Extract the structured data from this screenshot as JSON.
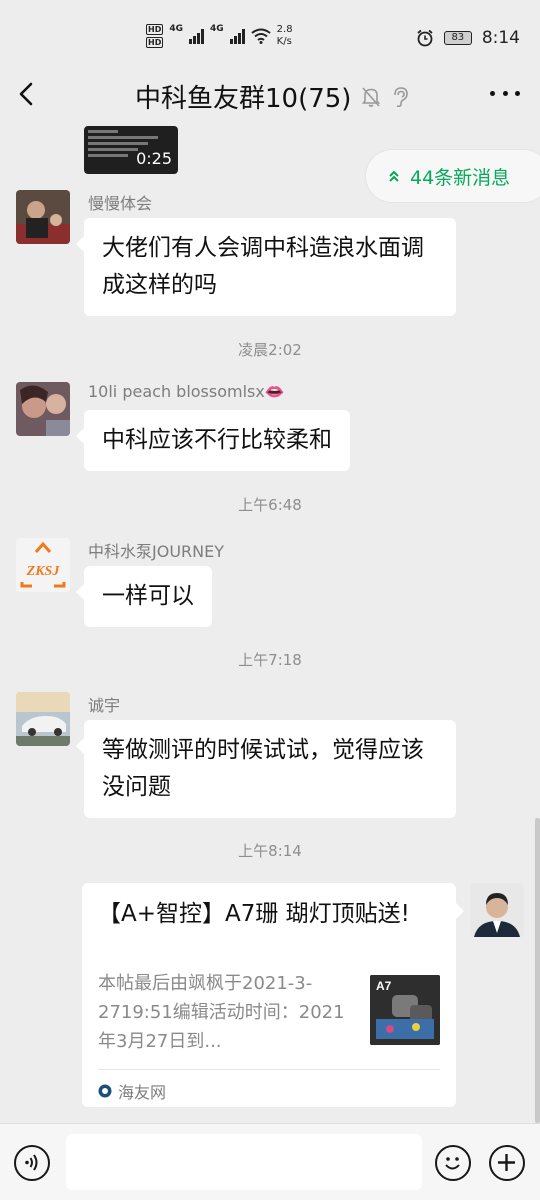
{
  "status_bar": {
    "hd1": "HD",
    "hd2": "HD",
    "net1": "4G",
    "net2": "4G",
    "speed_value": "2.8",
    "speed_unit": "K/s",
    "battery": "83",
    "time": "8:14"
  },
  "header": {
    "title": "中科鱼友群10(75)"
  },
  "video": {
    "duration": "0:25"
  },
  "new_messages": {
    "label": "44条新消息"
  },
  "messages": [
    {
      "sender": "慢慢体会",
      "text": "大佬们有人会调中科造浪水面调成这样的吗"
    },
    {
      "time": "凌晨2:02"
    },
    {
      "sender": "10li peach blossomlsx👄",
      "text": "中科应该不行比较柔和"
    },
    {
      "time": "上午6:48"
    },
    {
      "sender": "中科水泵JOURNEY",
      "avatar_text": "ZKSJ",
      "text": "一样可以"
    },
    {
      "time": "上午7:18"
    },
    {
      "sender": "诚宇",
      "text": "等做测评的时候试试，觉得应该没问题"
    },
    {
      "time": "上午8:14"
    }
  ],
  "link_card": {
    "title": "【A+智控】A7珊 瑚灯顶贴送!",
    "description": "本帖最后由飒枫于2021-3-2719:51编辑活动时间：2021年3月27日到...",
    "thumb_label": "A7",
    "source": "海友网"
  },
  "colors": {
    "accent_green": "#07a95c",
    "background": "#ededed",
    "bubble": "#ffffff"
  },
  "icons": {
    "back": "chevron-left-icon",
    "mute": "bell-slash-icon",
    "ear": "ear-icon",
    "more": "more-dots-icon",
    "voice": "voice-icon",
    "emoji": "emoji-icon",
    "add": "plus-icon"
  }
}
